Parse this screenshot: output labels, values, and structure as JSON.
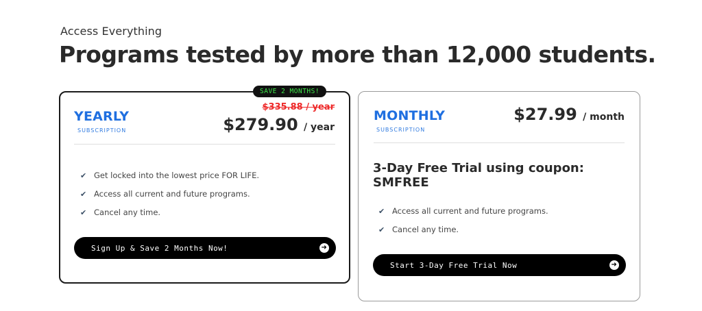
{
  "header": {
    "eyebrow": "Access Everything",
    "headline": "Programs tested by more than 12,000 students."
  },
  "yearly": {
    "badge": "SAVE 2 MONTHS!",
    "name": "YEARLY",
    "subtitle": "SUBSCRIPTION",
    "old_price": "$335.88 / year",
    "price": "$279.90",
    "period": "/ year",
    "features": [
      "Get locked into the lowest price FOR LIFE.",
      "Access all current and future programs.",
      "Cancel any time."
    ],
    "cta_label": "Sign Up & Save 2 Months Now!"
  },
  "monthly": {
    "name": "MONTHLY",
    "subtitle": "SUBSCRIPTION",
    "price": "$27.99",
    "period": "/ month",
    "trial_line1": "3-Day Free Trial using coupon:",
    "trial_line2": "SMFREE",
    "features": [
      "Access all current and future programs.",
      "Cancel any time."
    ],
    "cta_label": "Start 3-Day Free Trial Now"
  },
  "icons": {
    "check": "check-icon",
    "arrow": "arrow-right-circle-icon"
  },
  "colors": {
    "accent_blue": "#1f6fe0",
    "strike_red": "#ee2a2a",
    "badge_green": "#3ee84a",
    "cta_black": "#000000"
  }
}
